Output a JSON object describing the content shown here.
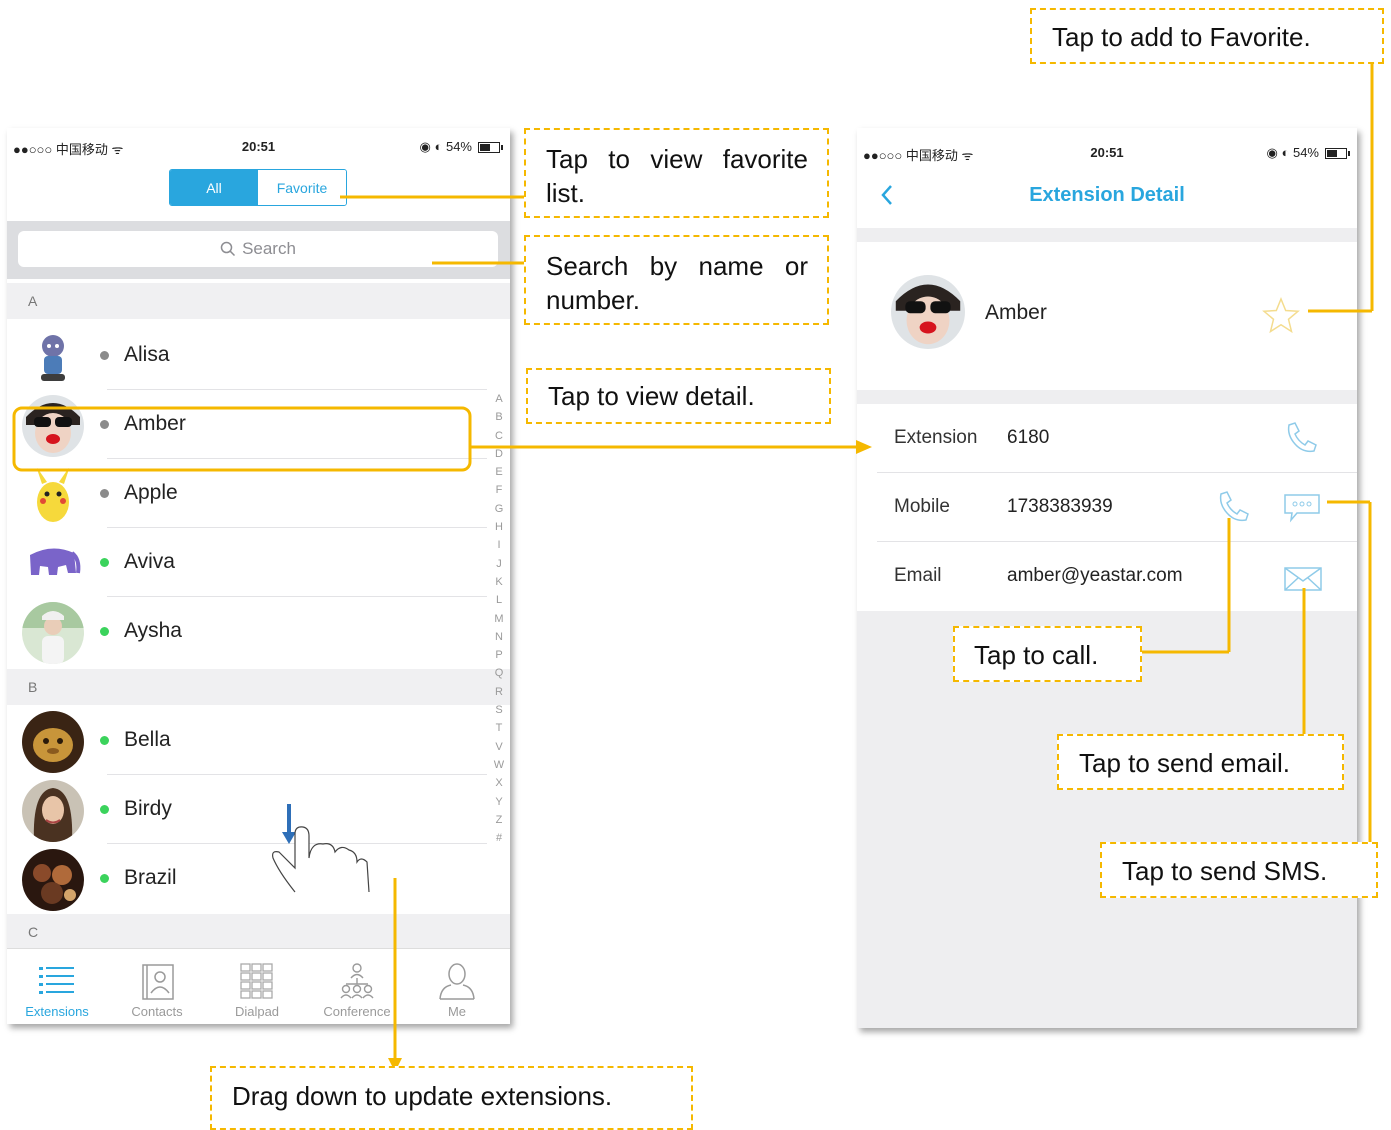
{
  "left_phone": {
    "status": {
      "carrier": "●●○○○ 中国移动 ᯤ",
      "time": "20:51",
      "right": "◉ ◐ 54%"
    },
    "segmented": {
      "all": "All",
      "favorite": "Favorite"
    },
    "search": {
      "placeholder": "Search"
    },
    "sections": [
      "A",
      "B",
      "C"
    ],
    "contacts": [
      {
        "name": "Alisa",
        "status": "gray"
      },
      {
        "name": "Amber",
        "status": "gray"
      },
      {
        "name": "Apple",
        "status": "gray"
      },
      {
        "name": "Aviva",
        "status": "green"
      },
      {
        "name": "Aysha",
        "status": "green"
      },
      {
        "name": "Bella",
        "status": "green"
      },
      {
        "name": "Birdy",
        "status": "green"
      },
      {
        "name": "Brazil",
        "status": "green"
      }
    ],
    "index": [
      "A",
      "B",
      "C",
      "D",
      "E",
      "F",
      "G",
      "H",
      "I",
      "J",
      "K",
      "L",
      "M",
      "N",
      "P",
      "Q",
      "R",
      "S",
      "T",
      "V",
      "W",
      "X",
      "Y",
      "Z",
      "#"
    ],
    "tabs": [
      {
        "label": "Extensions",
        "icon": "list-icon",
        "active": true
      },
      {
        "label": "Contacts",
        "icon": "contact-book-icon",
        "active": false
      },
      {
        "label": "Dialpad",
        "icon": "dialpad-icon",
        "active": false
      },
      {
        "label": "Conference",
        "icon": "conference-icon",
        "active": false
      },
      {
        "label": "Me",
        "icon": "person-icon",
        "active": false
      }
    ]
  },
  "right_phone": {
    "status": {
      "carrier": "●●○○○ 中国移动 ᯤ",
      "time": "20:51",
      "right": "◉ ◐ 54%"
    },
    "title": "Extension Detail",
    "profile_name": "Amber",
    "rows": [
      {
        "label": "Extension",
        "value": "6180"
      },
      {
        "label": "Mobile",
        "value": "1738383939"
      },
      {
        "label": "Email",
        "value": "amber@yeastar.com"
      }
    ]
  },
  "callouts": {
    "favorite_list": "Tap to view favorite list.",
    "search": "Search by name or number.",
    "view_detail": "Tap to view detail.",
    "drag_down": "Drag down to update extensions.",
    "add_favorite": "Tap to add to Favorite.",
    "call": "Tap to call.",
    "send_email": "Tap to send email.",
    "send_sms": "Tap to send SMS."
  },
  "colors": {
    "accent": "#29a6de",
    "callout": "#f5b800",
    "online": "#3bd35c",
    "offline": "#8b8b8b"
  }
}
